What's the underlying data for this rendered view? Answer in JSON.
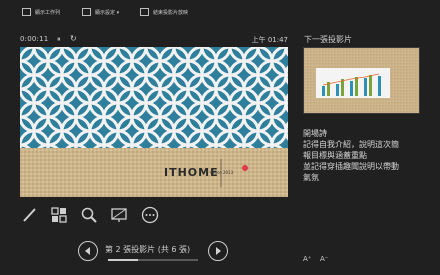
{
  "toolbar": {
    "items": [
      {
        "label": "顯示工作列",
        "icon": "taskbar-icon"
      },
      {
        "label": "顯示設定 ▾",
        "icon": "display-settings-icon"
      },
      {
        "label": "結束投影片放映",
        "icon": "end-show-icon"
      }
    ]
  },
  "presenter": {
    "timer": "0:00:11",
    "pause_glyph": "⏸",
    "reset_glyph": "↻",
    "clock": "上午 01:47"
  },
  "current_slide": {
    "title": "ITHOME",
    "subtitle": "Office 2013",
    "colors": {
      "pattern_bg": "#2d7f9c",
      "pattern_line": "#f2f2f2",
      "burlap": "#cdb58c",
      "laser": "#e0384a"
    }
  },
  "tools": {
    "items": [
      "pen-icon",
      "slides-grid-icon",
      "zoom-icon",
      "screen-icon",
      "more-icon"
    ]
  },
  "navigation": {
    "label": "第 2 張投影片 (共 6 張)",
    "progress_fraction": 0.333
  },
  "next_slide": {
    "label": "下一張投影片"
  },
  "notes": {
    "lines": [
      "開場詩",
      "記得自我介紹，說明這次簡",
      "報目標與涵蓋重點",
      "並記得穿插趣聞說明以帶動",
      "氣氛"
    ]
  },
  "font_controls": {
    "increase": "A⁺",
    "decrease": "A⁻"
  }
}
